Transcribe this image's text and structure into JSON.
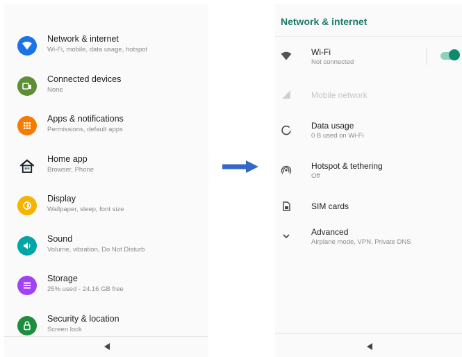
{
  "left": {
    "items": [
      {
        "title": "Network & internet",
        "subtitle": "Wi-Fi, mobile, data usage, hotspot",
        "icon": "wifi-icon",
        "color": "#1a73e8"
      },
      {
        "title": "Connected devices",
        "subtitle": "None",
        "icon": "devices-icon",
        "color": "#5d8f35"
      },
      {
        "title": "Apps & notifications",
        "subtitle": "Permissions, default apps",
        "icon": "apps-icon",
        "color": "#f57c00"
      },
      {
        "title": "Home app",
        "subtitle": "Browser, Phone",
        "icon": "home-icon",
        "color": "#2e7d32"
      },
      {
        "title": "Display",
        "subtitle": "Wallpaper, sleep, font size",
        "icon": "brightness-icon",
        "color": "#f4b400"
      },
      {
        "title": "Sound",
        "subtitle": "Volume, vibration, Do Not Disturb",
        "icon": "volume-icon",
        "color": "#00a5a5"
      },
      {
        "title": "Storage",
        "subtitle": "25% used - 24.16 GB free",
        "icon": "storage-icon",
        "color": "#a142f4"
      },
      {
        "title": "Security & location",
        "subtitle": "Screen lock",
        "icon": "lock-icon",
        "color": "#1e8e3e"
      }
    ]
  },
  "right": {
    "title": "Network & internet",
    "items": [
      {
        "title": "Wi-Fi",
        "subtitle": "Not connected",
        "icon": "wifi-icon",
        "toggle": true
      },
      {
        "title": "Mobile network",
        "subtitle": "",
        "icon": "signal-icon",
        "disabled": true
      },
      {
        "title": "Data usage",
        "subtitle": "0 B used on Wi-Fi",
        "icon": "data-usage-icon"
      },
      {
        "title": "Hotspot & tethering",
        "subtitle": "Off",
        "icon": "hotspot-icon"
      },
      {
        "title": "SIM cards",
        "subtitle": "",
        "icon": "sim-card-icon"
      },
      {
        "title": "Advanced",
        "subtitle": "Airplane mode, VPN, Private DNS",
        "icon": "chevron-down-icon"
      }
    ]
  },
  "colors": {
    "accent": "#1b7a6b",
    "arrow": "#3367c8",
    "toggle_on": "#0f8a6c"
  }
}
